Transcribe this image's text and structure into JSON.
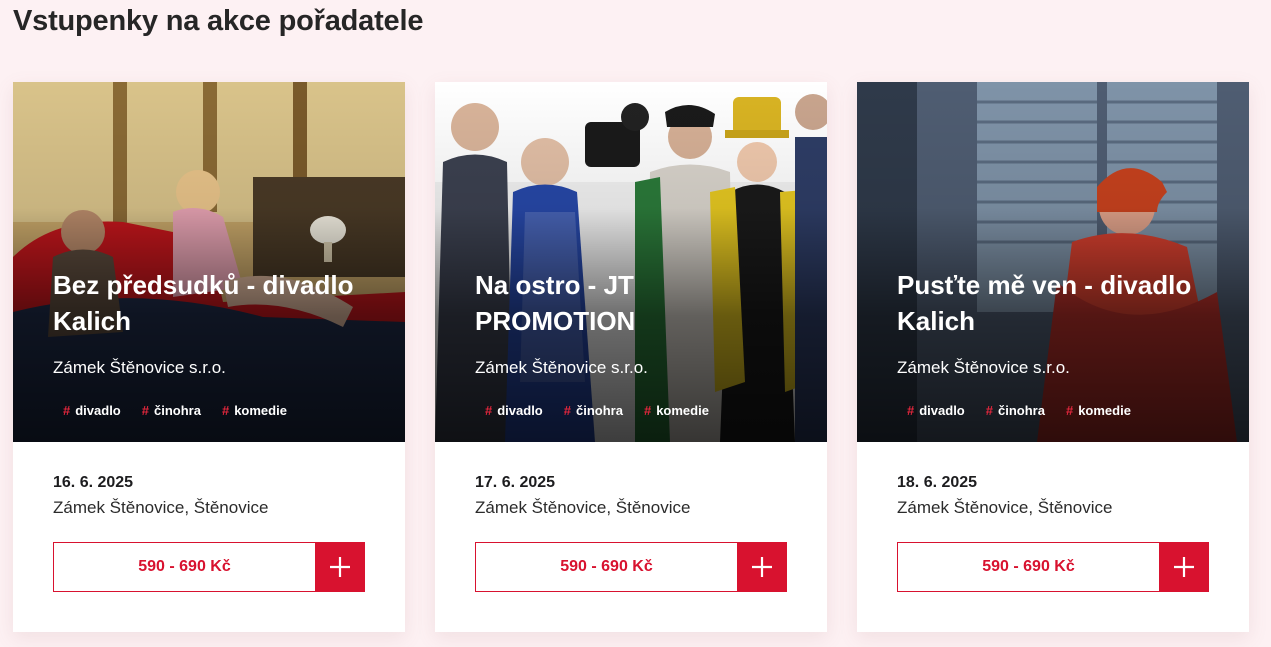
{
  "page": {
    "title": "Vstupenky na akce pořadatele"
  },
  "events": [
    {
      "title": "Bez předsudků - divadlo Kalich",
      "organizer": "Zámek Štěnovice s.r.o.",
      "tags": [
        "divadlo",
        "činohra",
        "komedie"
      ],
      "date": "16. 6. 2025",
      "venue": "Zámek Štěnovice, Štěnovice",
      "price": "590 - 690 Kč"
    },
    {
      "title": "Na ostro - JT PROMOTION",
      "organizer": "Zámek Štěnovice s.r.o.",
      "tags": [
        "divadlo",
        "činohra",
        "komedie"
      ],
      "date": "17. 6. 2025",
      "venue": "Zámek Štěnovice, Štěnovice",
      "price": "590 - 690 Kč"
    },
    {
      "title": "Pusťte mě ven - divadlo Kalich",
      "organizer": "Zámek Štěnovice s.r.o.",
      "tags": [
        "divadlo",
        "činohra",
        "komedie"
      ],
      "date": "18. 6. 2025",
      "venue": "Zámek Štěnovice, Štěnovice",
      "price": "590 - 690 Kč"
    }
  ],
  "icons": {
    "tag": "hash-icon",
    "add": "plus-icon"
  },
  "colors": {
    "accent": "#d8122f",
    "background": "#fdf1f3",
    "tag_hash": "#e0263c"
  }
}
